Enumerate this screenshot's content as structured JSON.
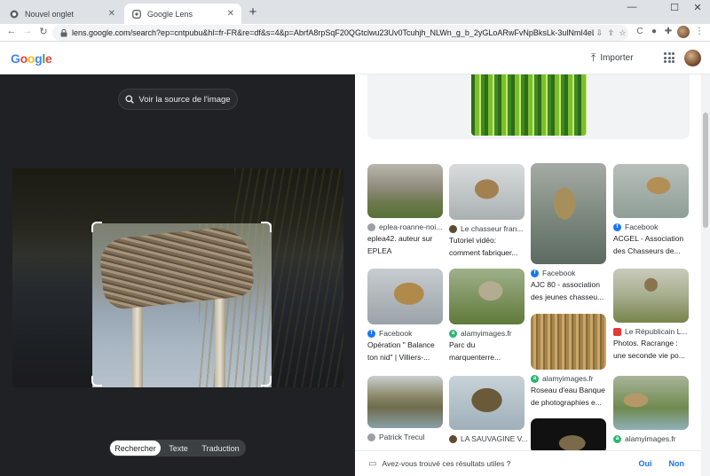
{
  "browser": {
    "tabs": [
      {
        "title": "Nouvel onglet",
        "active": false
      },
      {
        "title": "Google Lens",
        "active": true
      }
    ],
    "url": "lens.google.com/search?ep=cntpubu&hl=fr-FR&re=df&s=4&p=AbrfA8rpSqF20QGtclwu23Uv0Tcuhjh_NLWn_g_b_2yGLoARwFvNpBksLk-3ulNmI4eLo_88BPy3e..."
  },
  "header": {
    "logo": [
      "G",
      "o",
      "o",
      "g",
      "l",
      "e"
    ],
    "import_label": "Importer"
  },
  "lens": {
    "source_button_label": "Voir la source de l'image",
    "modes": [
      "Rechercher",
      "Texte",
      "Traduction"
    ]
  },
  "results": [
    {
      "source": "eplea-roanne-noi...",
      "desc": "eplea42. auteur sur",
      "desc2": "EPLEA",
      "icon": "generic"
    },
    {
      "source": "Le chasseur fran...",
      "desc": "Tutoriel vidéo:",
      "desc2": "comment fabriquer...",
      "icon": "duck"
    },
    {
      "source": "Facebook",
      "desc": "AJC 80 - association",
      "desc2": "des jeunes chasseu...",
      "icon": "fb"
    },
    {
      "source": "Facebook",
      "desc": "ACGEL - Association",
      "desc2": "des Chasseurs de...",
      "icon": "fb"
    },
    {
      "source": "Facebook",
      "desc": "Opération \" Balance",
      "desc2": "ton nid\" | Villiers-...",
      "icon": "fb"
    },
    {
      "source": "alamyimages.fr",
      "desc": "Parc du",
      "desc2": "marquenterre...",
      "icon": "alamy"
    },
    {
      "source": "alamyimages.fr",
      "desc": "Roseau d'eau Banque",
      "desc2": "de photographies e...",
      "icon": "alamy"
    },
    {
      "source": "Le Républicain L...",
      "desc": "Photos. Racrange :",
      "desc2": "une seconde vie po...",
      "icon": "rep"
    },
    {
      "source": "Patrick Trecul",
      "desc": "",
      "desc2": "",
      "icon": "generic"
    },
    {
      "source": "LA SAUVAGINE V...",
      "desc": "",
      "desc2": "",
      "icon": "duck"
    },
    {
      "source": "alamyimages.fr",
      "desc": "",
      "desc2": "",
      "icon": "alamy"
    }
  ],
  "feedback": {
    "question": "Avez-vous trouvé ces résultats utiles ?",
    "yes": "Oui",
    "no": "Non"
  },
  "colors": {
    "accent": "#1a73e8",
    "dark_panel": "#202124",
    "facebook": "#1877f2"
  }
}
